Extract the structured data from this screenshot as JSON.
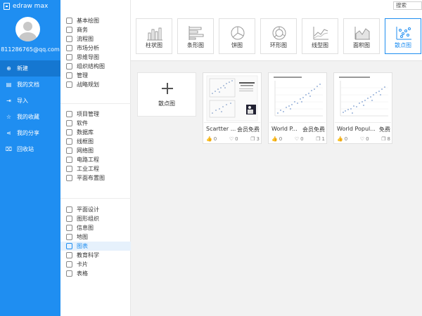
{
  "app": {
    "logo": "edraw max"
  },
  "user": {
    "email": "811286765@qq.com"
  },
  "nav": [
    {
      "label": "新建",
      "icon": "new-file-icon",
      "glyph": "⊕"
    },
    {
      "label": "我的文档",
      "icon": "document-icon",
      "glyph": "▤"
    },
    {
      "label": "导入",
      "icon": "import-icon",
      "glyph": "⇥"
    },
    {
      "label": "我的收藏",
      "icon": "star-icon",
      "glyph": "☆"
    },
    {
      "label": "我的分享",
      "icon": "share-icon",
      "glyph": "⋖"
    },
    {
      "label": "回收站",
      "icon": "trash-icon",
      "glyph": "⌧"
    }
  ],
  "categories": {
    "group1": [
      "基本绘图",
      "商务",
      "流程图",
      "市场分析",
      "思维导图",
      "组织结构图",
      "管理",
      "战略规划"
    ],
    "group2": [
      "项目管理",
      "软件",
      "数据库",
      "线框图",
      "网络图",
      "电路工程",
      "工业工程",
      "平面布置图"
    ],
    "group3": [
      "平面设计",
      "图形组织",
      "信息图",
      "地图",
      "图表",
      "教育科学",
      "卡片",
      "表格"
    ]
  },
  "search": {
    "label": "搜索"
  },
  "chart_types": [
    {
      "label": "柱状图",
      "icon": "bar-chart-icon"
    },
    {
      "label": "条形图",
      "icon": "horizontal-bar-chart-icon"
    },
    {
      "label": "饼图",
      "icon": "pie-chart-icon"
    },
    {
      "label": "环形图",
      "icon": "donut-chart-icon"
    },
    {
      "label": "线型图",
      "icon": "line-chart-icon"
    },
    {
      "label": "面积图",
      "icon": "area-chart-icon"
    },
    {
      "label": "散点图",
      "icon": "scatter-chart-icon"
    }
  ],
  "new_card": {
    "label": "散点图"
  },
  "templates": [
    {
      "name": "Scartter ...",
      "badge": "会员免费",
      "likes": "0",
      "favorites": "0",
      "copies": "3"
    },
    {
      "name": "World P...",
      "badge": "会员免费",
      "likes": "0",
      "favorites": "0",
      "copies": "1"
    },
    {
      "name": "World Popul...",
      "badge": "免费",
      "likes": "0",
      "favorites": "0",
      "copies": "8"
    }
  ],
  "colors": {
    "accent": "#1f8ef1",
    "sidebar": "#1f8ef1",
    "active_nav": "#1577d1"
  }
}
